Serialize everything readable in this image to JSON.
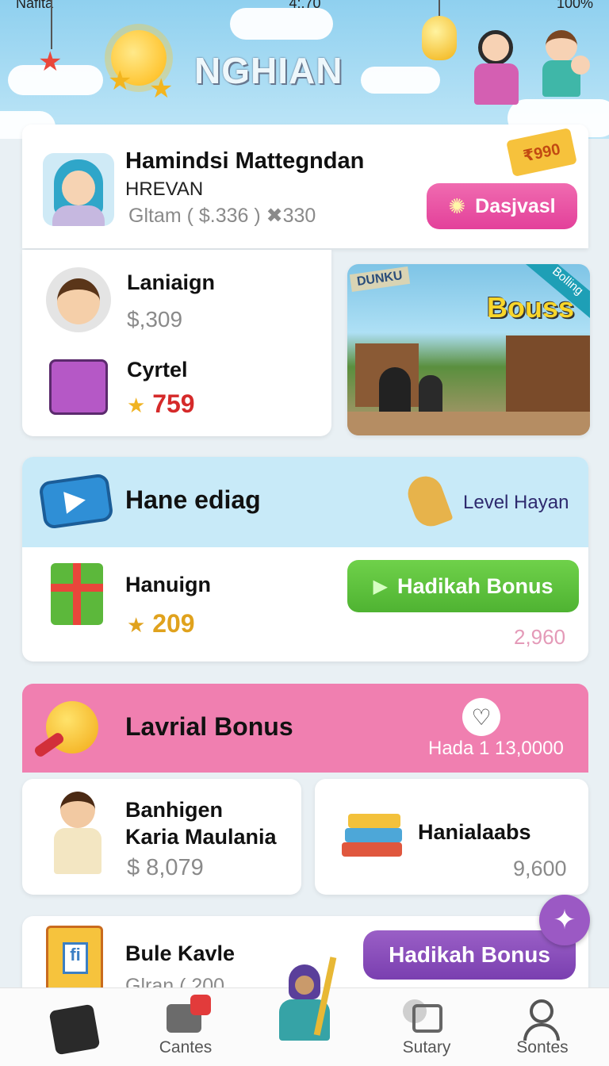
{
  "status": {
    "carrier": "Nafita",
    "time": "4:.70",
    "battery": "100%"
  },
  "header": {
    "title": "NGHIAN"
  },
  "profile": {
    "name": "Hamindsi Mattegndan",
    "code": "HREVAN",
    "stats": "Gltam ( $.336 ) ✖330",
    "badge": "₹990",
    "button_label": "Dasjvasl"
  },
  "rewards_list": [
    {
      "title": "Laniaign",
      "value": "$,309"
    },
    {
      "title": "Cyrtel",
      "value": "759"
    }
  ],
  "banner": {
    "badge": "Bouss",
    "corner": "Bolling",
    "sign": "DUNKU"
  },
  "game_section": {
    "title": "Hane ediag",
    "level_label": "Level Hayan",
    "item_title": "Hanuign",
    "item_value": "209",
    "button_label": "Hadikah Bonus",
    "secondary_value": "2,960"
  },
  "bonus_section": {
    "title": "Lavrial Bonus",
    "amount": "Hada 1 13,0000",
    "card1": {
      "name_line1": "Banhigen",
      "name_line2": "Karia Maulania",
      "value": "$ 8,079"
    },
    "card2": {
      "title": "Hanialaabs",
      "value": "9,600"
    }
  },
  "bottom_card": {
    "title": "Bule Kavle",
    "subtitle": "Glran ( 200",
    "button_label": "Hadikah Bonus"
  },
  "nav": [
    {
      "label": ""
    },
    {
      "label": "Cantes"
    },
    {
      "label": ""
    },
    {
      "label": "Sutary"
    },
    {
      "label": "Sontes"
    }
  ],
  "colors": {
    "pink_button": "#e6479a",
    "green_button": "#5cc43c",
    "purple_button": "#8a4fb8",
    "section_blue": "#c8eaf8",
    "section_pink": "#f07fb0",
    "red_value": "#d52a2a",
    "gold_value": "#e0a21d"
  }
}
